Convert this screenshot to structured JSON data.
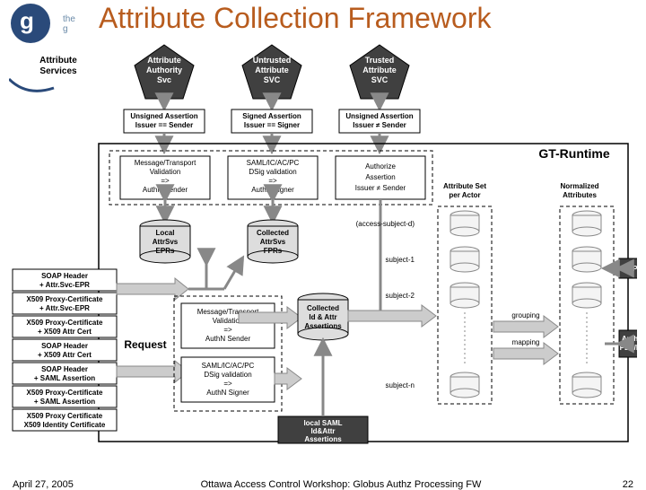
{
  "logo": {
    "tag": "the g"
  },
  "title": "Attribute Collection Framework",
  "footer": {
    "date": "April 27, 2005",
    "center": "Ottawa Access Control Workshop: Globus Authz Processing FW",
    "page": "22"
  },
  "svc_label": {
    "l1": "Attribute",
    "l2": "Services"
  },
  "pentagons": {
    "p1": {
      "l1": "Attribute",
      "l2": "Authority",
      "l3": "Svc"
    },
    "p2": {
      "l1": "Untrusted",
      "l2": "Attribute",
      "l3": "SVC"
    },
    "p3": {
      "l1": "Trusted",
      "l2": "Attribute",
      "l3": "SVC"
    }
  },
  "assert": {
    "a1": {
      "l1": "Unsigned Assertion",
      "l2": "Issuer == Sender"
    },
    "a2": {
      "l1": "Signed Assertion",
      "l2": "Issuer == Signer"
    },
    "a3": {
      "l1": "Unsigned Assertion",
      "l2": "Issuer ≠ Sender"
    }
  },
  "valid": {
    "v1": {
      "l1": "Message/Transport",
      "l2": "Validation",
      "l3": "=>",
      "l4": "AuthN Sender"
    },
    "v2": {
      "l1": "SAML/IC/AC/PC",
      "l2": "DSig validation",
      "l3": "=>",
      "l4": "AuthN Signer"
    },
    "v3": {
      "l1": "Authorize",
      "l2": "Assertion",
      "l3": "Issuer ≠ Sender"
    }
  },
  "epr": {
    "e1": {
      "l1": "Local",
      "l2": "AttrSvs",
      "l3": "EPRs"
    },
    "e2": {
      "l1": "Collected",
      "l2": "AttrSvs",
      "l3": "FPRs"
    }
  },
  "request_label": "Request",
  "left": {
    "r1": {
      "l1": "SOAP Header",
      "l2": "+ Attr.Svc-EPR"
    },
    "r2": {
      "l1": "X509 Proxy-Certificate",
      "l2": "+ Attr.Svc-EPR"
    },
    "r3": {
      "l1": "X509 Proxy-Certificate",
      "l2": "+ X509 Attr Cert"
    },
    "r4": {
      "l1": "SOAP Header",
      "l2": "+ X509 Attr Cert"
    },
    "r5": {
      "l1": "SOAP Header",
      "l2": "+ SAML Assertion"
    },
    "r6": {
      "l1": "X509 Proxy-Certificate",
      "l2": "+ SAML Assertion"
    },
    "r7": {
      "l1": "X509 Proxy Certificate",
      "l2": "X509 Identity Certificate"
    }
  },
  "mid": {
    "m1": {
      "l1": "Message/Transport",
      "l2": "Validation",
      "l3": "=>",
      "l4": "AuthN Sender"
    },
    "m2": {
      "l1": "SAML/IC/AC/PC",
      "l2": "DSig validation",
      "l3": "=>",
      "l4": "AuthN Signer"
    },
    "coll": {
      "l1": "Collected",
      "l2": "Id & Attr",
      "l3": "Assertions"
    },
    "local": {
      "l1": "local SAML",
      "l2": "Id&Attr",
      "l3": "Assertions"
    }
  },
  "right": {
    "header": {
      "l1": "Attribute Set",
      "l2": "per Actor"
    },
    "norm": {
      "l1": "Normalized",
      "l2": "Attributes"
    },
    "rows": [
      "(access-subject-d)",
      "subject-1",
      "subject-2",
      "subject-n"
    ],
    "grouping": "grouping",
    "mapping": "mapping",
    "pip": "PIP…",
    "authz": {
      "l1": "Authz…",
      "l2": "PEP/PDP"
    }
  },
  "runtime": "GT-Runtime"
}
